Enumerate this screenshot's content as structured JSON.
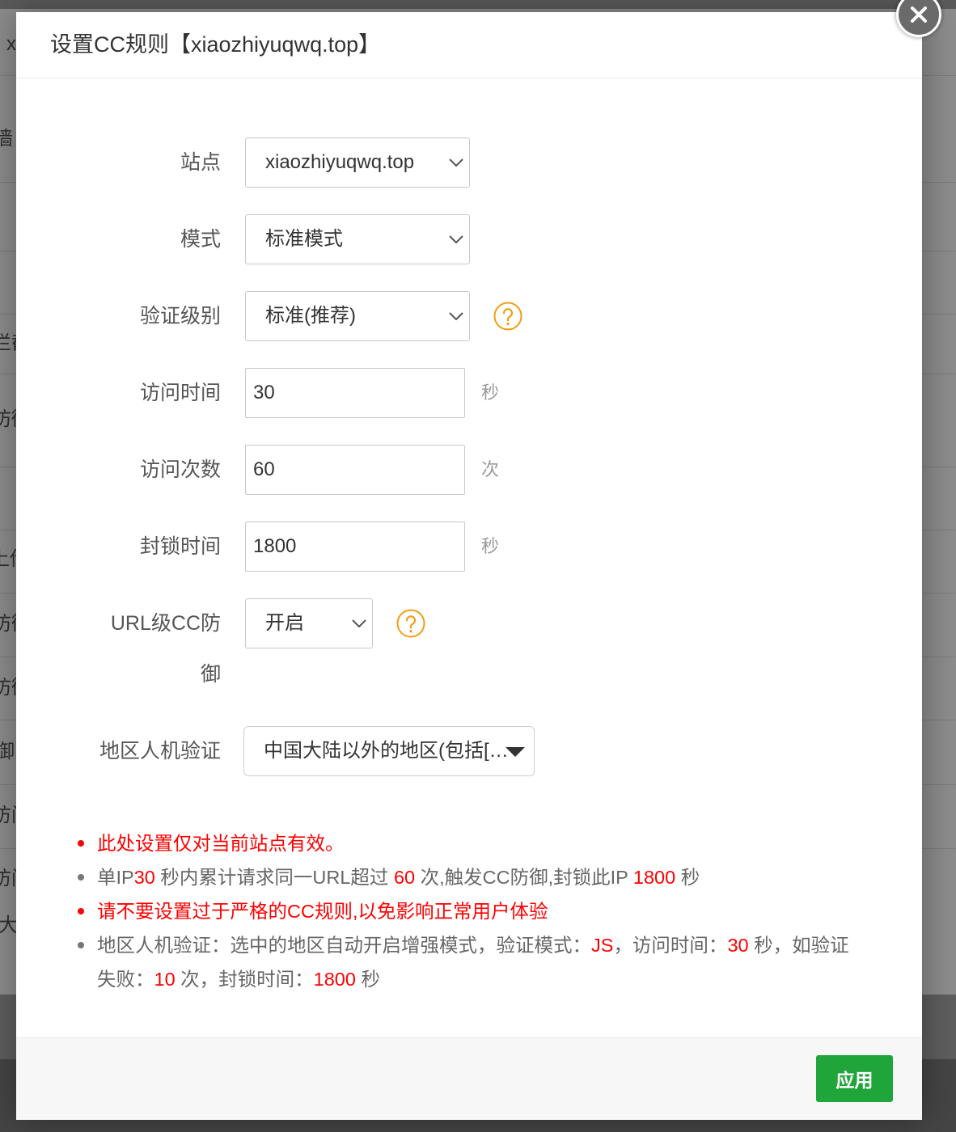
{
  "background": {
    "fragments": [
      "x",
      "墙",
      "拦截",
      "防御",
      "上传",
      "防御",
      "防御",
      "御",
      "访问",
      "访问",
      "大"
    ]
  },
  "dialog": {
    "title": "设置CC规则【xiaozhiyuqwq.top】",
    "close_icon": "close-icon"
  },
  "form": {
    "site": {
      "label": "站点",
      "value": "xiaozhiyuqwq.top",
      "icon": "chevron-down-icon"
    },
    "mode": {
      "label": "模式",
      "value": "标准模式",
      "icon": "chevron-down-icon"
    },
    "verify_level": {
      "label": "验证级别",
      "value": "标准(推荐)",
      "icon": "chevron-down-icon",
      "help_icon": "question-circle-icon"
    },
    "visit_time": {
      "label": "访问时间",
      "value": "30",
      "unit": "秒"
    },
    "visit_count": {
      "label": "访问次数",
      "value": "60",
      "unit": "次"
    },
    "block_time": {
      "label": "封锁时间",
      "value": "1800",
      "unit": "秒"
    },
    "url_cc_defense": {
      "label": "URL级CC防御",
      "value": "开启",
      "icon": "chevron-down-icon",
      "help_icon": "question-circle-icon"
    },
    "region_verify": {
      "label": "地区人机验证",
      "value": "中国大陆以外的地区(包括[…",
      "icon": "caret-down-icon"
    }
  },
  "notes": [
    {
      "color": "#ff0000",
      "segments": [
        {
          "text": "此处设置仅对当前站点有效。"
        }
      ]
    },
    {
      "color": "#666666",
      "segments": [
        {
          "text": "单IP"
        },
        {
          "text": "30",
          "color": "#ff0000"
        },
        {
          "text": " 秒内累计请求同一URL超过 "
        },
        {
          "text": "60",
          "color": "#ff0000"
        },
        {
          "text": " 次,触发CC防御,封锁此IP "
        },
        {
          "text": "1800",
          "color": "#ff0000"
        },
        {
          "text": " 秒"
        }
      ]
    },
    {
      "color": "#ff0000",
      "segments": [
        {
          "text": "请不要设置过于严格的CC规则,以免影响正常用户体验"
        }
      ]
    },
    {
      "color": "#666666",
      "segments": [
        {
          "text": "地区人机验证：选中的地区自动开启增强模式，验证模式："
        },
        {
          "text": "JS",
          "color": "#ff0000"
        },
        {
          "text": "，访问时间："
        },
        {
          "text": "30",
          "color": "#ff0000"
        },
        {
          "text": " 秒，如验证"
        },
        {
          "text": "失败："
        },
        {
          "text": "10",
          "color": "#ff0000"
        },
        {
          "text": " 次，封锁时间："
        },
        {
          "text": "1800",
          "color": "#ff0000"
        },
        {
          "text": " 秒"
        }
      ]
    }
  ],
  "footer": {
    "apply_label": "应用"
  },
  "colors": {
    "primary_green": "#20a53a",
    "warning_red": "#ff0000",
    "help_orange": "#f39c12",
    "note_gray": "#666666",
    "close_button": "#6a6a6a"
  }
}
